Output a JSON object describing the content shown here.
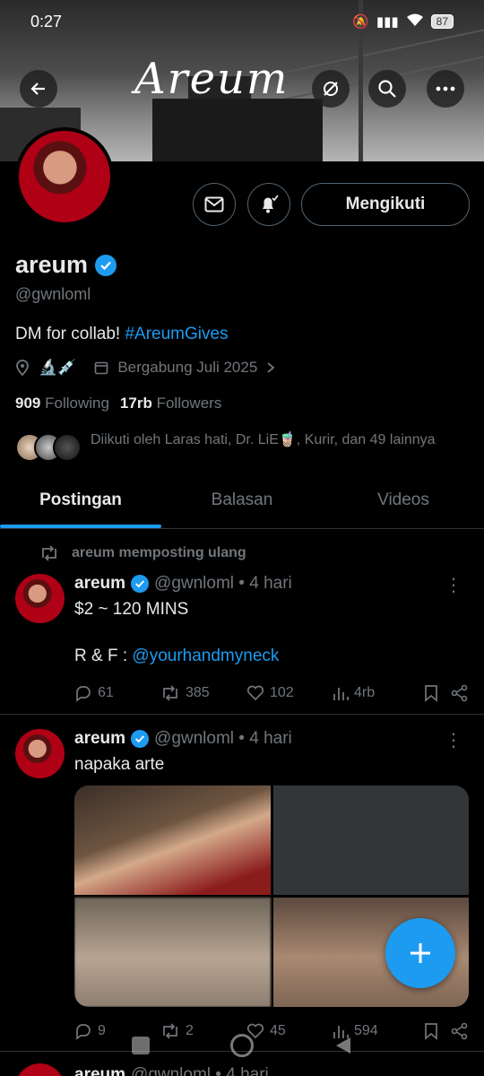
{
  "status_bar": {
    "time": "0:27",
    "battery": "87"
  },
  "banner": {
    "logo_text": "Areum"
  },
  "profile": {
    "name": "areum",
    "handle": "@gwnloml",
    "bio_text": "DM for collab! ",
    "bio_hashtag": "#AreumGives",
    "location_emoji": "🔬💉",
    "joined": "Bergabung Juli 2025",
    "following_count": "909",
    "following_label": "Following",
    "followers_count": "17rb",
    "followers_label": "Followers",
    "followed_by": "Diikuti oleh Laras hati, Dr. LiE🧋, Kurir, dan 49 lainnya",
    "follow_button": "Mengikuti"
  },
  "tabs": [
    {
      "label": "Postingan"
    },
    {
      "label": "Balasan"
    },
    {
      "label": "Videos"
    }
  ],
  "posts": [
    {
      "repost_label": "areum memposting ulang",
      "name": "areum",
      "handle_time": "@gwnloml • 4 hari",
      "text_line1": "$2 ~ 120 MINS",
      "text_line2_prefix": "R & F : ",
      "text_mention": "@yourhandmyneck",
      "replies": "61",
      "reposts": "385",
      "likes": "102",
      "views": "4rb"
    },
    {
      "name": "areum",
      "handle_time": "@gwnloml • 4 hari",
      "text_line1": "napaka arte",
      "replies": "9",
      "reposts": "2",
      "likes": "45",
      "views": "594"
    }
  ],
  "peek_post": {
    "name": "areum",
    "handle_time": "@gwnloml • 4 hari"
  },
  "colors": {
    "accent": "#1d9bf0",
    "background": "#000000",
    "muted": "#71767b"
  }
}
